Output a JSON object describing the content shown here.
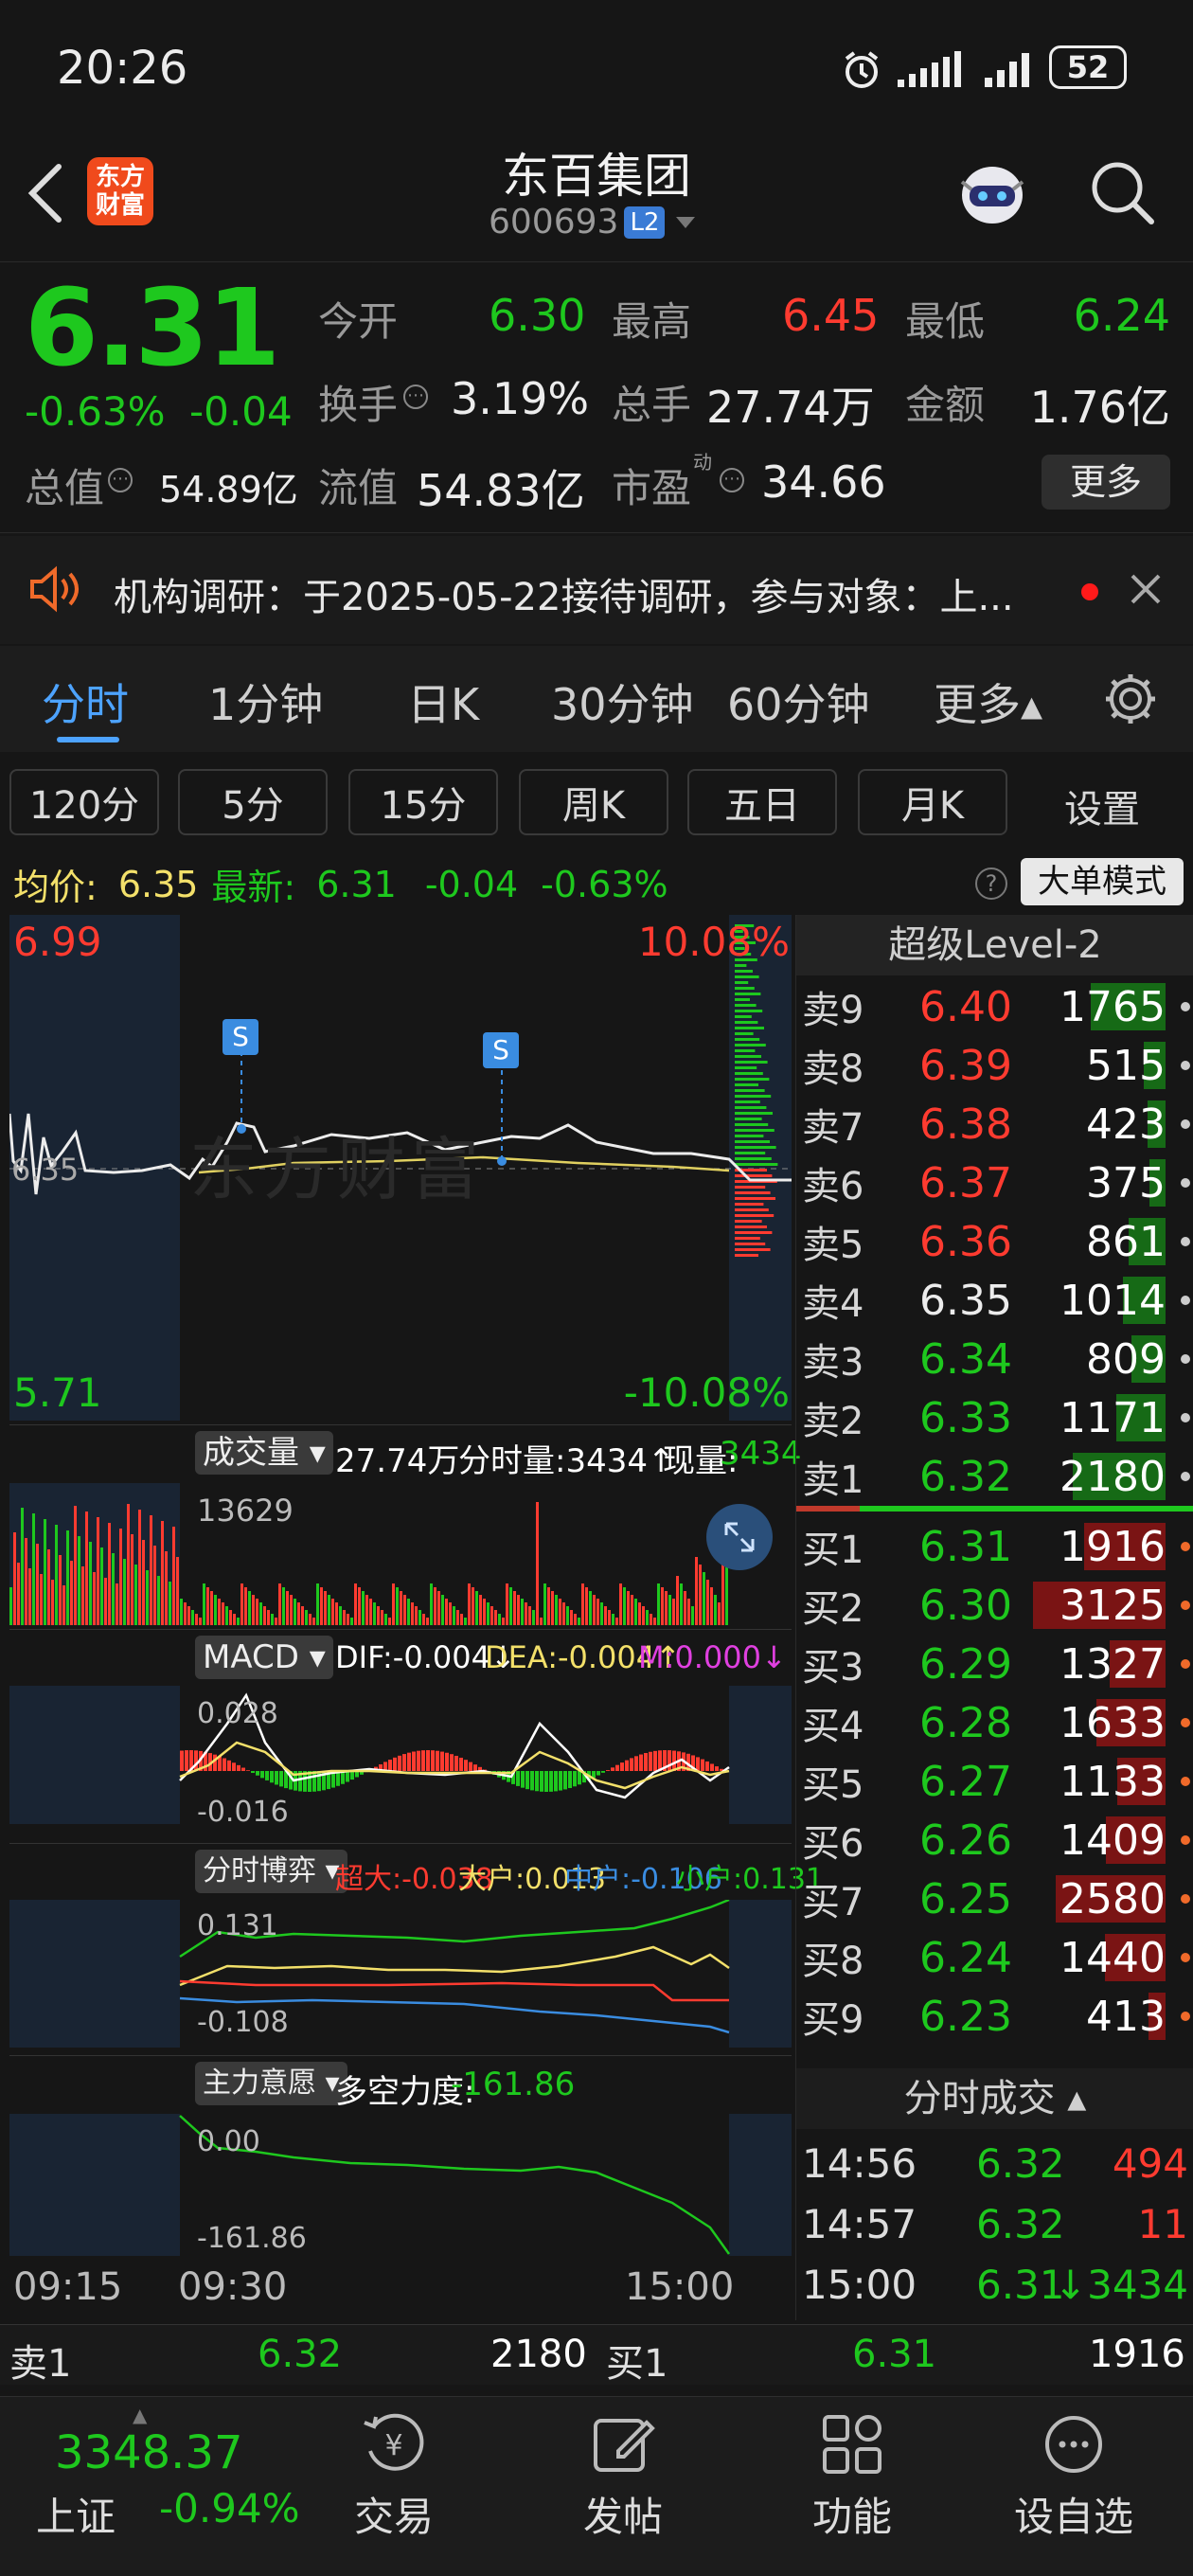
{
  "status": {
    "time": "20:26",
    "battery": "52"
  },
  "header": {
    "logo_line1": "东方",
    "logo_line2": "财富",
    "title": "东百集团",
    "code": "600693",
    "level_badge": "L2"
  },
  "quote": {
    "price": "6.31",
    "change_pct": "-0.63%",
    "change": "-0.04",
    "r1": [
      {
        "k": "今开",
        "v": "6.30"
      },
      {
        "k": "最高",
        "v": "6.45"
      },
      {
        "k": "最低",
        "v": "6.24"
      }
    ],
    "r2": [
      {
        "k": "换手",
        "v": "3.19%"
      },
      {
        "k": "总手",
        "v": "27.74万"
      },
      {
        "k": "金额",
        "v": "1.76亿"
      }
    ],
    "r3": [
      {
        "k": "总值",
        "v": "54.89亿"
      },
      {
        "k": "流值",
        "v": "54.83亿"
      },
      {
        "k": "市盈",
        "v": "34.66",
        "sup": "动"
      }
    ],
    "more": "更多"
  },
  "notice": {
    "text": "机构调研：于2025-05-22接待调研，参与对象：上..."
  },
  "tabs": [
    "分时",
    "1分钟",
    "日K",
    "30分钟",
    "60分钟",
    "更多▴"
  ],
  "subtabs": [
    "120分",
    "5分",
    "15分",
    "周K",
    "五日",
    "月K",
    "设置"
  ],
  "avgbar": {
    "avg_label": "均价:",
    "avg": "6.35",
    "last_label": "最新:",
    "last": "6.31",
    "chg": "-0.04",
    "pct": "-0.63%",
    "mode": "大单模式"
  },
  "chart": {
    "top_left": "6.99",
    "top_right": "10.08%",
    "bottom_left": "5.71",
    "bottom_right": "-10.08%",
    "mid": "6.35",
    "marker": "S",
    "watermark": "东方财富"
  },
  "volume": {
    "dropdown": "成交量",
    "total": "27.74万",
    "tick_label": "分时量:3434↑",
    "now_label": "现量:",
    "now": "3434",
    "max": "13629"
  },
  "macd": {
    "dropdown": "MACD",
    "dif": "DIF:-0.004↓",
    "dea": "DEA:-0.004↑",
    "m": "M:0.000↓",
    "top": "0.028",
    "bottom": "-0.016"
  },
  "game": {
    "dropdown": "分时博弈",
    "cd": "超大:-0.038",
    "dh": "大户:0.013",
    "zh": "中户:-0.106",
    "xh": "小户:0.131",
    "top": "0.131",
    "bottom": "-0.108"
  },
  "intent": {
    "dropdown": "主力意愿",
    "label": "多空力度:",
    "value": "-161.86",
    "top": "0.00",
    "bottom": "-161.86"
  },
  "times": [
    "09:15",
    "09:30",
    "15:00"
  ],
  "book": {
    "title": "超级Level-2",
    "sells": [
      {
        "l": "卖9",
        "p": "6.40",
        "v": "1765"
      },
      {
        "l": "卖8",
        "p": "6.39",
        "v": "515"
      },
      {
        "l": "卖7",
        "p": "6.38",
        "v": "423"
      },
      {
        "l": "卖6",
        "p": "6.37",
        "v": "375"
      },
      {
        "l": "卖5",
        "p": "6.36",
        "v": "861"
      },
      {
        "l": "卖4",
        "p": "6.35",
        "v": "1014"
      },
      {
        "l": "卖3",
        "p": "6.34",
        "v": "809"
      },
      {
        "l": "卖2",
        "p": "6.33",
        "v": "1171"
      },
      {
        "l": "卖1",
        "p": "6.32",
        "v": "2180"
      }
    ],
    "buys": [
      {
        "l": "买1",
        "p": "6.31",
        "v": "1916"
      },
      {
        "l": "买2",
        "p": "6.30",
        "v": "3125"
      },
      {
        "l": "买3",
        "p": "6.29",
        "v": "1327"
      },
      {
        "l": "买4",
        "p": "6.28",
        "v": "1633"
      },
      {
        "l": "买5",
        "p": "6.27",
        "v": "1133"
      },
      {
        "l": "买6",
        "p": "6.26",
        "v": "1409"
      },
      {
        "l": "买7",
        "p": "6.25",
        "v": "2580"
      },
      {
        "l": "买8",
        "p": "6.24",
        "v": "1440"
      },
      {
        "l": "买9",
        "p": "6.23",
        "v": "413"
      }
    ],
    "ticks_title": "分时成交",
    "ticks": [
      {
        "t": "14:56",
        "p": "6.32",
        "v": "494"
      },
      {
        "t": "14:57",
        "p": "6.32",
        "v": "11"
      },
      {
        "t": "15:00",
        "p": "6.31",
        "v": "↓3434"
      }
    ]
  },
  "bottomquote": {
    "s_label": "卖1",
    "s_price": "6.32",
    "s_vol": "2180",
    "b_label": "买1",
    "b_price": "6.31",
    "b_vol": "1916"
  },
  "nav": {
    "index_value": "3348.37",
    "index_name": "上证",
    "index_pct": "-0.94%",
    "items": [
      "交易",
      "发帖",
      "功能",
      "设自选"
    ]
  }
}
